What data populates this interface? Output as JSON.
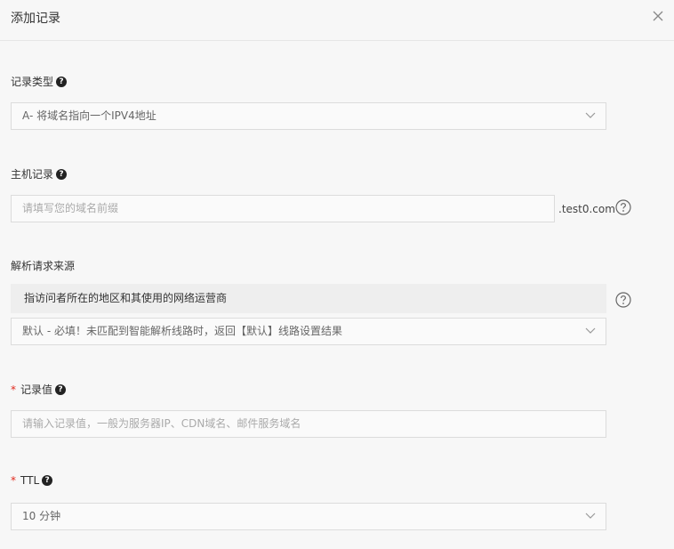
{
  "header": {
    "title": "添加记录"
  },
  "record_type": {
    "label": "记录类型",
    "value": "A- 将域名指向一个IPV4地址"
  },
  "host_record": {
    "label": "主机记录",
    "placeholder": "请填写您的域名前缀",
    "suffix": ".test0.com"
  },
  "request_source": {
    "label": "解析请求来源",
    "hint": "指访问者所在的地区和其使用的网络运营商",
    "value": "默认 - 必填！未匹配到智能解析线路时，返回【默认】线路设置结果"
  },
  "record_value": {
    "required_mark": "*",
    "label": "记录值",
    "placeholder": "请输入记录值，一般为服务器IP、CDN域名、邮件服务域名"
  },
  "ttl": {
    "required_mark": "*",
    "label": "TTL",
    "value": "10 分钟"
  },
  "icons": {
    "help": "question-circle-icon",
    "close": "close-icon",
    "chevron": "chevron-down-icon"
  },
  "colors": {
    "required": "#e0291d",
    "border": "#dcdcdc",
    "background": "#f7f7f7"
  }
}
